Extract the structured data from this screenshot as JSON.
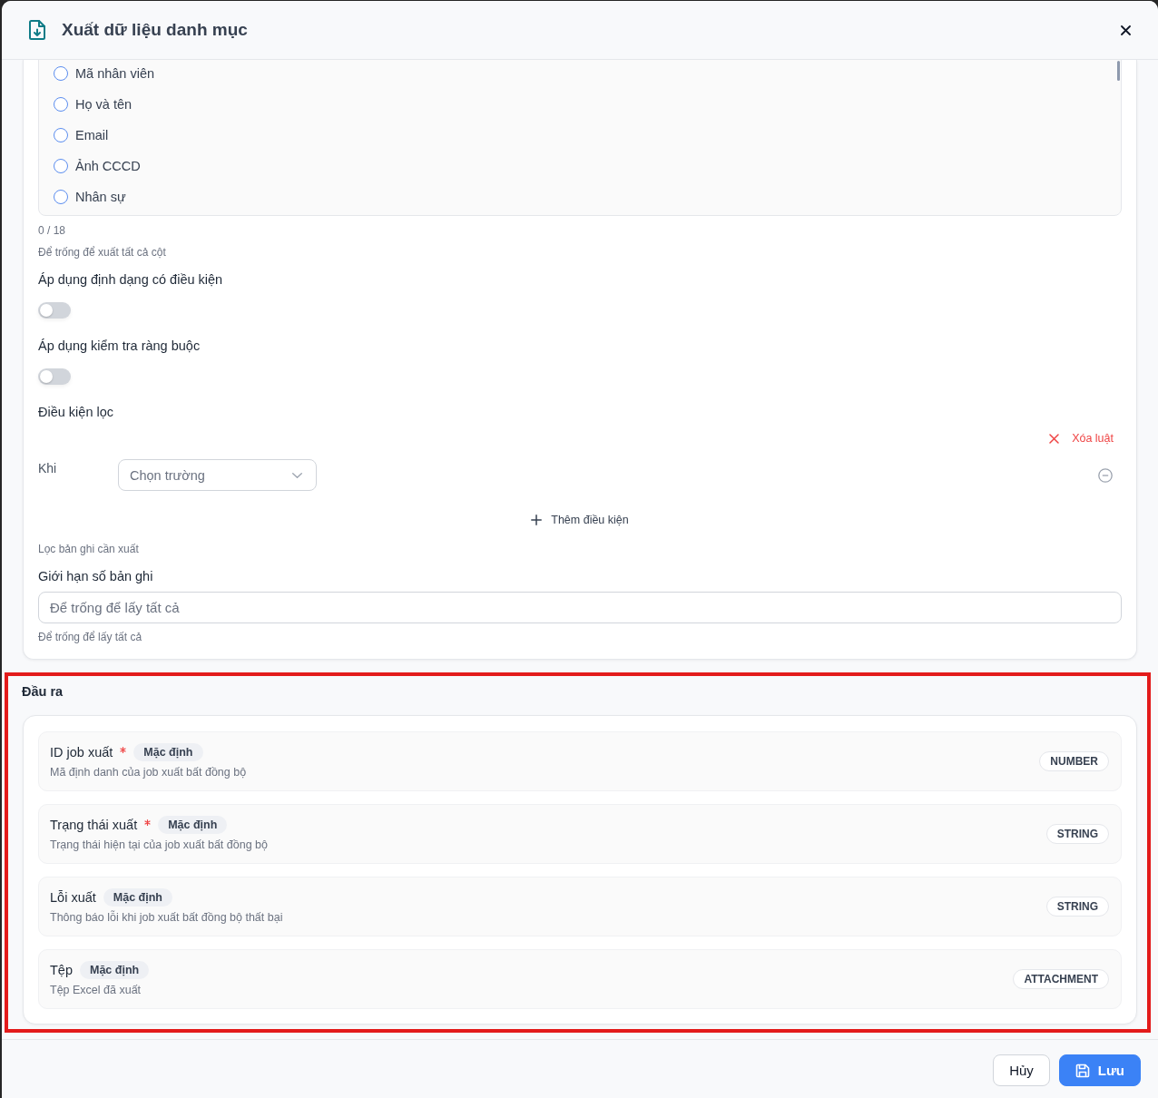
{
  "dialog": {
    "title": "Xuất dữ liệu danh mục"
  },
  "columns": {
    "options": [
      {
        "label": "Mã nhân viên",
        "checked": false
      },
      {
        "label": "Họ và tên",
        "checked": false
      },
      {
        "label": "Email",
        "checked": false
      },
      {
        "label": "Ảnh CCCD",
        "checked": false
      },
      {
        "label": "Nhân sự",
        "checked": false
      }
    ],
    "count": "0 / 18",
    "hint": "Để trống để xuất tất cả cột"
  },
  "settings": [
    {
      "label": "Áp dụng định dạng có điều kiện",
      "on": false
    },
    {
      "label": "Áp dụng kiểm tra ràng buộc",
      "on": false
    }
  ],
  "filter": {
    "label": "Điều kiện lọc",
    "clear_rule": "Xóa luật",
    "when": "Khi",
    "field_select": {
      "placeholder": "Chọn trường"
    },
    "add_condition": "Thêm điều kiện",
    "hint": "Lọc bản ghi cần xuất"
  },
  "limit": {
    "label": "Giới hạn số bản ghi",
    "placeholder": "Để trống để lấy tất cả",
    "hint": "Để trống để lấy tất cả"
  },
  "output": {
    "title": "Đầu ra",
    "highlighted": true,
    "fields": [
      {
        "name": "ID job xuất",
        "required": true,
        "badge": "Mặc định",
        "description": "Mã định danh của job xuất bất đồng bộ",
        "type": "NUMBER"
      },
      {
        "name": "Trạng thái xuất",
        "required": true,
        "badge": "Mặc định",
        "description": "Trạng thái hiện tại của job xuất bất đồng bộ",
        "type": "STRING"
      },
      {
        "name": "Lỗi xuất",
        "required": false,
        "badge": "Mặc định",
        "description": "Thông báo lỗi khi job xuất bất đồng bộ thất bại",
        "type": "STRING"
      },
      {
        "name": "Tệp",
        "required": false,
        "badge": "Mặc định",
        "description": "Tệp Excel đã xuất",
        "type": "ATTACHMENT"
      }
    ]
  },
  "footer": {
    "buttons": [
      {
        "label": "Hủy",
        "kind": "secondary"
      },
      {
        "label": "Lưu",
        "kind": "primary"
      }
    ]
  }
}
